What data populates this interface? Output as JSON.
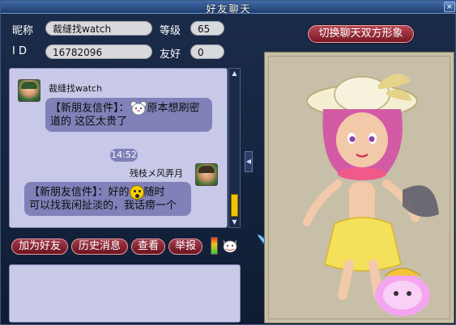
{
  "window": {
    "title": "好友聊天",
    "close_glyph": "×"
  },
  "profile": {
    "nickname_label": "昵称",
    "nickname": "裁缝找watch",
    "id_label": "I D",
    "id": "16782096",
    "level_label": "等级",
    "level": "65",
    "friendship_label": "友好",
    "friendship": "0"
  },
  "switch_button": "切换聊天双方形象",
  "chat": {
    "msg1": {
      "name": "裁缝找watch",
      "tag": "【新朋友信件】：",
      "text": "原本想刷密道的 这区太贵了"
    },
    "time": "14:52",
    "msg2": {
      "name": "残枝メ风弄月",
      "tag": "【新朋友信件】：好的",
      "text1": "随时",
      "text2": "可以找我闲扯淡的，我话痨一个"
    }
  },
  "actions": {
    "add_friend": "加为好友",
    "history": "历史消息",
    "view": "查看",
    "report": "举报"
  },
  "colors": {
    "button_red": "#8a2233",
    "chat_bg": "#c8c9e8",
    "bubble": "#7f81b8",
    "scroll_thumb": "#f2c300"
  },
  "icons": {
    "close": "close-icon",
    "signal": "signal-icon",
    "pet": "pet-cat-icon",
    "feather": "feather-icon"
  }
}
